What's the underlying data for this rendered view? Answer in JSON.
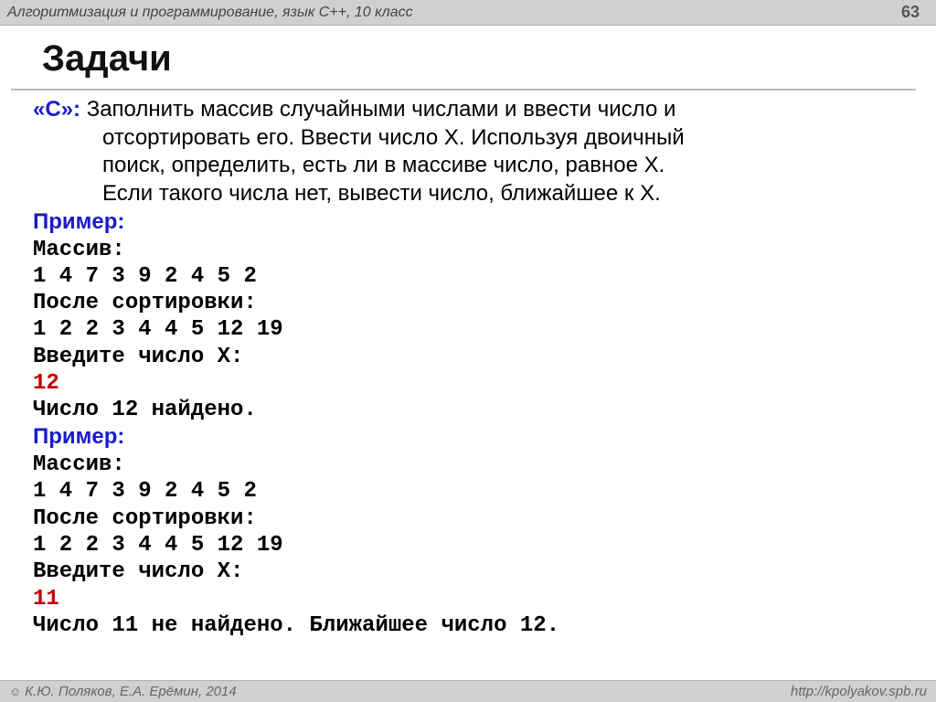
{
  "header": {
    "course": "Алгоритмизация и программирование, язык C++, 10 класс",
    "page": "63"
  },
  "title": "Задачи",
  "task": {
    "label": "«C»:",
    "lines": [
      "Заполнить массив случайными числами и ввести число и",
      "отсортировать его.  Ввести число X. Используя двоичный",
      "поиск, определить, есть ли в массиве число, равное X.",
      "Если такого числа нет, вывести число, ближайшее к X."
    ]
  },
  "example_label": "Пример:",
  "ex1": {
    "l0": "Массив:",
    "l1": "1 4 7 3 9 2 4 5 2",
    "l2": "После сортировки:",
    "l3": "1 2 2 3 4 4 5 12 19",
    "l4": "Введите число X:",
    "l5": "12",
    "l6": "Число 12 найдено."
  },
  "ex2": {
    "l0": "Массив:",
    "l1": "1 4 7 3 9 2 4 5 2",
    "l2": "После сортировки:",
    "l3": "1 2 2 3 4 4 5 12 19",
    "l4": "Введите число X:",
    "l5": "11",
    "l6": "Число 11 не найдено. Ближайшее число 12."
  },
  "footer": {
    "copyright": "К.Ю. Поляков, Е.А. Ерёмин, 2014",
    "url": "http://kpolyakov.spb.ru"
  }
}
